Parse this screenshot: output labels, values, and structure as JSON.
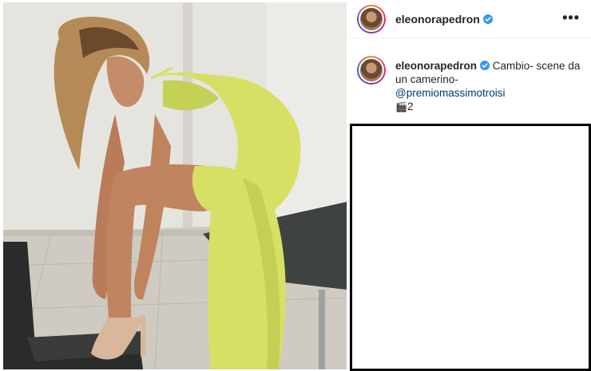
{
  "post": {
    "username": "eleonorapedron",
    "verified": true,
    "more_icon": "more-horizontal-icon",
    "caption": {
      "username": "eleonorapedron",
      "text_line1": "Cambio- scene da",
      "text_line2": "un camerino-",
      "mention": "@premiomassimotroisi",
      "emoji": "🎬",
      "count": "2"
    }
  },
  "colors": {
    "verified_badge": "#3897f0",
    "mention": "#00376b",
    "dress": "#d9e46a",
    "wall": "#e4e2dd"
  }
}
